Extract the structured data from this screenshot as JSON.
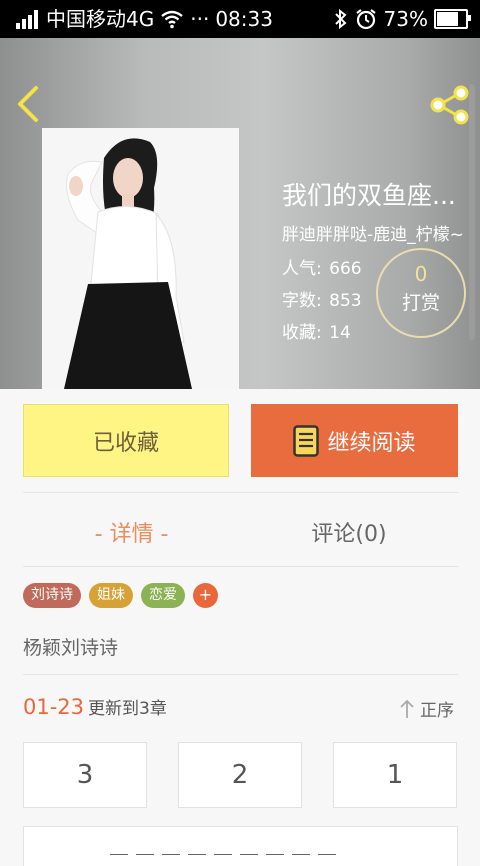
{
  "status_bar": {
    "carrier": "中国移动4G",
    "dots": "···",
    "time": "08:33",
    "battery": "73%",
    "icons": [
      "signal-icon",
      "wifi-icon",
      "bluetooth-icon",
      "alarm-icon",
      "battery-icon"
    ]
  },
  "book": {
    "title": "我们的双鱼座...",
    "author": "胖迪胖胖哒-鹿迪_柠檬~",
    "stats": [
      {
        "label": "人气:",
        "value": "666"
      },
      {
        "label": "字数:",
        "value": "853"
      },
      {
        "label": "收藏:",
        "value": "14"
      }
    ],
    "reward": {
      "count": "0",
      "label": "打赏"
    }
  },
  "actions": {
    "favorited_label": "已收藏",
    "continue_label": "继续阅读"
  },
  "tabs": [
    {
      "label": "- 详情 -",
      "active": true
    },
    {
      "label": "评论(0)",
      "active": false
    }
  ],
  "tags": [
    {
      "label": "刘诗诗",
      "color": "#c06a5b"
    },
    {
      "label": "姐妹",
      "color": "#d6a135"
    },
    {
      "label": "恋爱",
      "color": "#8bb253"
    }
  ],
  "tag_add": "+",
  "description": "杨颖刘诗诗",
  "update": {
    "date": "01-23",
    "text": "更新到3章"
  },
  "sort_label": "正序",
  "chapters": [
    "3",
    "2",
    "1"
  ],
  "colors": {
    "accent": "#e8683c",
    "favorite_bg": "#fff585",
    "reward_num": "#f4e29a"
  }
}
